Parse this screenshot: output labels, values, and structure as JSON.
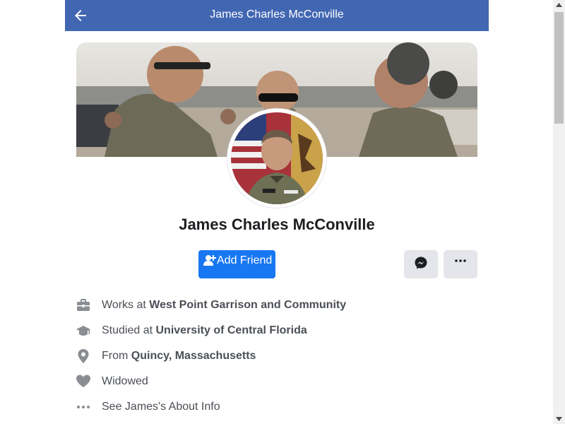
{
  "header": {
    "title": "James Charles McConville",
    "back_icon": "arrow-left-icon",
    "background": "#4267b2"
  },
  "profile": {
    "name": "James Charles McConville",
    "cover_photo": "soldiers-talking-photo",
    "avatar_photo": "general-portrait-photo"
  },
  "actions": {
    "add_friend_label": "Add Friend",
    "add_friend_icon": "add-friend-icon",
    "message_icon": "messenger-icon",
    "more_icon": "more-dots-icon",
    "accent": "#1877f2"
  },
  "info": [
    {
      "icon": "briefcase-icon",
      "prefix": "Works at ",
      "bold": "West Point Garrison and Community"
    },
    {
      "icon": "graduation-cap-icon",
      "prefix": "Studied at ",
      "bold": "University of Central Florida"
    },
    {
      "icon": "location-pin-icon",
      "prefix": "From ",
      "bold": "Quincy, Massachusetts"
    },
    {
      "icon": "heart-icon",
      "prefix": "Widowed",
      "bold": ""
    },
    {
      "icon": "more-dots-icon",
      "prefix": "See James's About Info",
      "bold": ""
    }
  ]
}
